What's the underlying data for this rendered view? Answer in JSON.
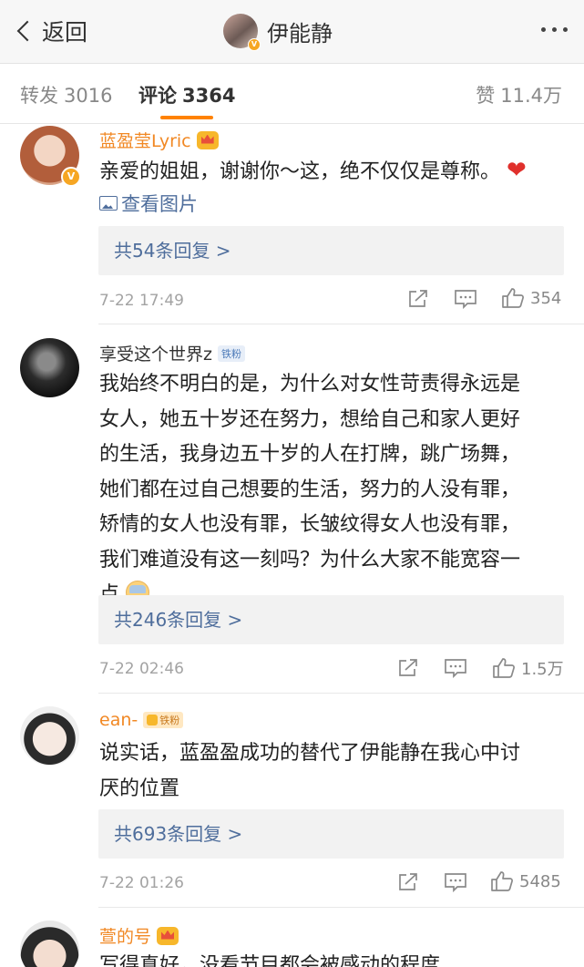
{
  "nav": {
    "back_label": "返回",
    "title": "伊能静",
    "verified_badge": "V"
  },
  "tabs": [
    {
      "label": "转发",
      "count": "3016"
    },
    {
      "label": "评论",
      "count": "3364"
    },
    {
      "label": "赞",
      "count": "11.4万"
    }
  ],
  "comments": [
    {
      "user": "蓝盈莹Lyric",
      "text": "亲爱的姐姐，谢谢你～这，绝不仅仅是尊称。",
      "pic_link": "查看图片",
      "replies": "共54条回复 >",
      "time": "7-22 17:49",
      "likes": "354"
    },
    {
      "user": "享受这个世界z",
      "badge": "铁粉",
      "lines": [
        "我始终不明白的是，为什么对女性苛责得永远是",
        "女人，她五十岁还在努力，想给自己和家人更好",
        "的生活，我身边五十岁的人在打牌，跳广场舞，",
        "她们都在过自己想要的生活，努力的人没有罪，",
        "矫情的女人也没有罪，长皱纹得女人也没有罪，",
        "我们难道没有这一刻吗？为什么大家不能宽容一",
        "点"
      ],
      "replies": "共246条回复 >",
      "time": "7-22 02:46",
      "likes": "1.5万"
    },
    {
      "user": "ean-",
      "badge": "铁粉",
      "lines": [
        "说实话，蓝盈盈成功的替代了伊能静在我心中讨",
        "厌的位置"
      ],
      "replies": "共693条回复 >",
      "time": "7-22 01:26",
      "likes": "5485"
    },
    {
      "user": "萱的号",
      "text": "写得真好，没看节目都会被感动的程度"
    }
  ],
  "colors": {
    "accent": "#ff8200",
    "link": "#4f6e9c",
    "username_orange": "#f18824"
  }
}
